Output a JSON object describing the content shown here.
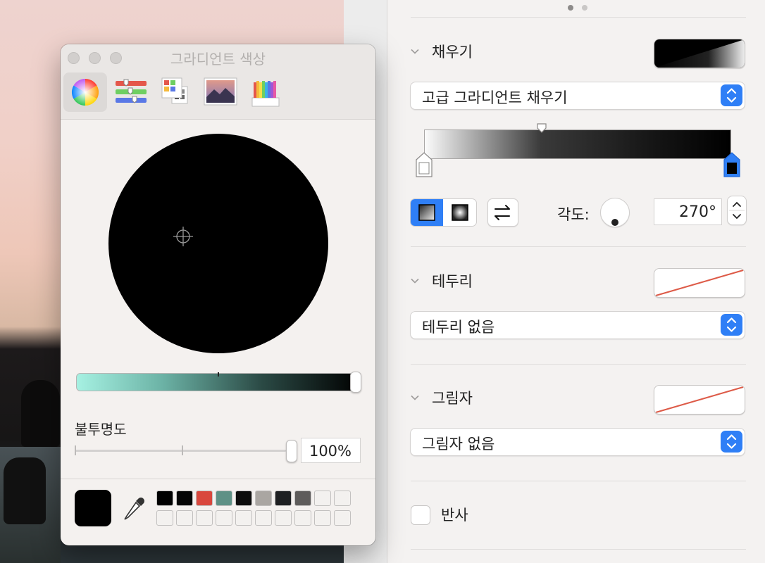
{
  "panel": {
    "title": "그라디언트 색상",
    "tools": [
      {
        "name": "color-wheel-icon"
      },
      {
        "name": "color-sliders-icon"
      },
      {
        "name": "color-palettes-icon"
      },
      {
        "name": "image-palettes-icon"
      },
      {
        "name": "pencils-icon"
      }
    ],
    "opacity_label": "불투명도",
    "opacity_value": "100%",
    "opacity_level": 1.0,
    "current_color": "#000000",
    "swatches": [
      "#000000",
      "#050505",
      "#d9473d",
      "#5f9186",
      "#0c0c0c",
      "#aaa6a2",
      "#1e2022",
      "#5e5c5b",
      "#f3f1ef",
      "#f3f1ef"
    ],
    "empty_swatch_color": "#f3f1ef"
  },
  "inspector": {
    "fill": {
      "title": "채우기",
      "type": "고급 그라디언트 채우기",
      "angle_label": "각도:",
      "angle_value": "270°"
    },
    "border": {
      "title": "테두리",
      "type": "테두리 없음"
    },
    "shadow": {
      "title": "그림자",
      "type": "그림자 없음"
    },
    "reflection": {
      "title": "반사"
    },
    "accent_color": "#2f7ff6"
  }
}
